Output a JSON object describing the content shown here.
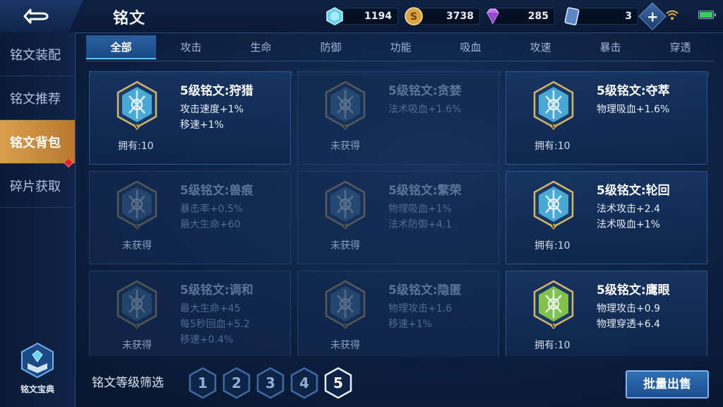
{
  "header": {
    "title": "铭文",
    "resources": [
      {
        "icon": "crystal-icon",
        "value": "1194"
      },
      {
        "icon": "gold-coin-icon",
        "value": "3738"
      },
      {
        "icon": "diamond-icon",
        "value": "285"
      },
      {
        "icon": "ticket-card-icon",
        "value": "3"
      }
    ]
  },
  "sidebar": {
    "items": [
      {
        "label": "铭文装配"
      },
      {
        "label": "铭文推荐"
      },
      {
        "label": "铭文背包",
        "active": true
      },
      {
        "label": "碎片获取"
      }
    ],
    "codex_label": "铭文宝典"
  },
  "tabs": [
    "全部",
    "攻击",
    "生命",
    "防御",
    "功能",
    "吸血",
    "攻速",
    "暴击",
    "穿透"
  ],
  "active_tab": "全部",
  "cards": [
    {
      "name": "5级铭文:狩猎",
      "attrs": [
        "攻击速度+1%",
        "移速+1%"
      ],
      "status": "拥有:10",
      "locked": false,
      "color": "#4fb6e0"
    },
    {
      "name": "5级铭文:贪婪",
      "attrs": [
        "法术吸血+1.6%"
      ],
      "status": "未获得",
      "locked": true,
      "color": "#4f86b0"
    },
    {
      "name": "5级铭文:夺萃",
      "attrs": [
        "物理吸血+1.6%"
      ],
      "status": "拥有:10",
      "locked": false,
      "color": "#4fb6e0"
    },
    {
      "name": "5级铭文:兽痕",
      "attrs": [
        "暴击率+0.5%",
        "最大生命+60"
      ],
      "status": "未获得",
      "locked": true,
      "color": "#4f86b0"
    },
    {
      "name": "5级铭文:繁荣",
      "attrs": [
        "物理吸血+1%",
        "法术防御+4.1"
      ],
      "status": "未获得",
      "locked": true,
      "color": "#4f86b0"
    },
    {
      "name": "5级铭文:轮回",
      "attrs": [
        "法术攻击+2.4",
        "法术吸血+1%"
      ],
      "status": "拥有:10",
      "locked": false,
      "color": "#4fb6e0"
    },
    {
      "name": "5级铭文:调和",
      "attrs": [
        "最大生命+45",
        "每5秒回血+5.2",
        "移速+0.4%"
      ],
      "status": "未获得",
      "locked": true,
      "color": "#4f86b0"
    },
    {
      "name": "5级铭文:隐匿",
      "attrs": [
        "物理攻击+1.6",
        "移速+1%"
      ],
      "status": "未获得",
      "locked": true,
      "color": "#4f86b0"
    },
    {
      "name": "5级铭文:鹰眼",
      "attrs": [
        "物理攻击+0.9",
        "物理穿透+6.4"
      ],
      "status": "拥有:10",
      "locked": false,
      "color": "#8fd04a"
    }
  ],
  "gem_level_mark": "V",
  "filter": {
    "label": "铭文等级筛选",
    "levels": [
      "1",
      "2",
      "3",
      "4",
      "5"
    ],
    "active_level": "5"
  },
  "sell_button": "批量出售"
}
